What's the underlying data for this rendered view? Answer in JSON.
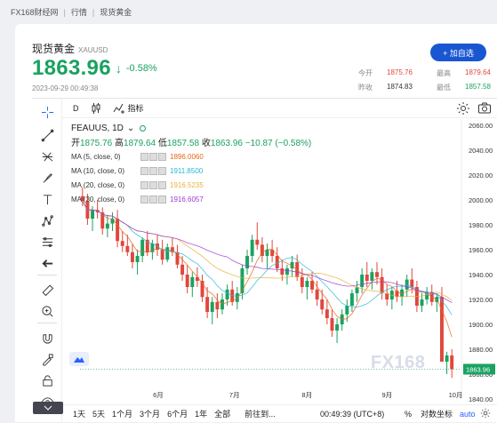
{
  "breadcrumb": [
    "FX168财经网",
    "行情",
    "现货黄金"
  ],
  "instrument": {
    "name": "现货黄金",
    "code": "XAUUSD"
  },
  "quote": {
    "price": "1863.96",
    "change_pct": "-0.58%",
    "datetime": "2023-09-29 00:49:38"
  },
  "add_watch_label": "+ 加自选",
  "stats": {
    "open_label": "今开",
    "open": "1875.76",
    "prev_label": "昨收",
    "prev": "1874.83",
    "high_label": "最高",
    "high": "1879.64",
    "low_label": "最低",
    "low": "1857.58"
  },
  "chart_toolbar": {
    "interval": "D",
    "indicators_label": "指标"
  },
  "legend": {
    "symbol": "FEAUUS, 1D",
    "open_label": "开",
    "open": "1875.76",
    "high_label": "高",
    "high": "1879.64",
    "low_label": "低",
    "low": "1857.58",
    "close_label": "收",
    "close": "1863.96",
    "change": "−10.87 (−0.58%)",
    "ma": [
      {
        "label": "MA (5, close, 0)",
        "value": "1896.0060",
        "color": "#e8661a"
      },
      {
        "label": "MA (10, close, 0)",
        "value": "1911.8500",
        "color": "#27b7d8"
      },
      {
        "label": "MA (20, close, 0)",
        "value": "1916.5235",
        "color": "#e8b23a"
      },
      {
        "label": "MA (30, close, 0)",
        "value": "1916.6057",
        "color": "#9b3bd4"
      }
    ]
  },
  "axis": {
    "y_ticks": [
      "2060.00",
      "2040.00",
      "2020.00",
      "2000.00",
      "1980.00",
      "1960.00",
      "1940.00",
      "1920.00",
      "1900.00",
      "1880.00",
      "1860.00",
      "1840.00"
    ],
    "x_ticks": [
      "6月",
      "7月",
      "8月",
      "9月",
      "10月"
    ],
    "last_price_tag": "1863.96"
  },
  "bottom": {
    "ranges": [
      "1天",
      "5天",
      "1个月",
      "3个月",
      "6个月",
      "1年",
      "全部"
    ],
    "goto": "前往到...",
    "clock": "00:49:39 (UTC+8)",
    "pct": "%",
    "log": "对数坐标",
    "auto": "auto"
  },
  "watermark": "FX168",
  "colors": {
    "up": "#1aa260",
    "down": "#e0473c",
    "accent": "#1956d2"
  },
  "chart_data": {
    "type": "candlestick",
    "ylim": [
      1840,
      2065
    ],
    "x_ticks": [
      "6月",
      "7月",
      "8月",
      "9月",
      "10月"
    ],
    "candles": [
      [
        2003,
        2010,
        1995,
        1999
      ],
      [
        1999,
        2005,
        1980,
        1985
      ],
      [
        1985,
        1995,
        1975,
        1992
      ],
      [
        1992,
        2000,
        1985,
        1990
      ],
      [
        1990,
        1994,
        1972,
        1977
      ],
      [
        1977,
        1988,
        1970,
        1981
      ],
      [
        1981,
        1990,
        1975,
        1985
      ],
      [
        1985,
        1992,
        1962,
        1967
      ],
      [
        1967,
        1975,
        1958,
        1963
      ],
      [
        1963,
        1972,
        1955,
        1958
      ],
      [
        1958,
        1965,
        1945,
        1950
      ],
      [
        1950,
        1960,
        1940,
        1955
      ],
      [
        1955,
        1970,
        1950,
        1968
      ],
      [
        1968,
        1975,
        1955,
        1958
      ],
      [
        1958,
        1968,
        1952,
        1965
      ],
      [
        1965,
        1972,
        1955,
        1960
      ],
      [
        1960,
        1968,
        1948,
        1952
      ],
      [
        1952,
        1965,
        1950,
        1962
      ],
      [
        1962,
        1970,
        1955,
        1958
      ],
      [
        1958,
        1964,
        1945,
        1948
      ],
      [
        1948,
        1955,
        1935,
        1940
      ],
      [
        1940,
        1948,
        1925,
        1930
      ],
      [
        1930,
        1942,
        1922,
        1938
      ],
      [
        1938,
        1946,
        1930,
        1935
      ],
      [
        1935,
        1940,
        1918,
        1922
      ],
      [
        1922,
        1930,
        1905,
        1910
      ],
      [
        1910,
        1922,
        1900,
        1918
      ],
      [
        1918,
        1925,
        1905,
        1912
      ],
      [
        1912,
        1925,
        1908,
        1920
      ],
      [
        1920,
        1932,
        1915,
        1928
      ],
      [
        1928,
        1935,
        1915,
        1918
      ],
      [
        1918,
        1930,
        1912,
        1925
      ],
      [
        1925,
        1948,
        1920,
        1945
      ],
      [
        1945,
        1960,
        1940,
        1955
      ],
      [
        1955,
        1972,
        1950,
        1968
      ],
      [
        1968,
        1982,
        1960,
        1964
      ],
      [
        1964,
        1970,
        1950,
        1955
      ],
      [
        1955,
        1965,
        1945,
        1960
      ],
      [
        1960,
        1968,
        1950,
        1955
      ],
      [
        1955,
        1962,
        1942,
        1945
      ],
      [
        1945,
        1952,
        1935,
        1940
      ],
      [
        1940,
        1948,
        1932,
        1945
      ],
      [
        1945,
        1955,
        1938,
        1950
      ],
      [
        1950,
        1956,
        1935,
        1938
      ],
      [
        1938,
        1945,
        1925,
        1930
      ],
      [
        1930,
        1938,
        1920,
        1935
      ],
      [
        1935,
        1942,
        1925,
        1928
      ],
      [
        1928,
        1935,
        1915,
        1920
      ],
      [
        1920,
        1928,
        1908,
        1912
      ],
      [
        1912,
        1920,
        1900,
        1905
      ],
      [
        1905,
        1912,
        1890,
        1895
      ],
      [
        1895,
        1905,
        1885,
        1900
      ],
      [
        1900,
        1912,
        1895,
        1908
      ],
      [
        1908,
        1920,
        1902,
        1915
      ],
      [
        1915,
        1928,
        1910,
        1925
      ],
      [
        1925,
        1935,
        1918,
        1930
      ],
      [
        1930,
        1945,
        1925,
        1940
      ],
      [
        1940,
        1950,
        1930,
        1935
      ],
      [
        1935,
        1945,
        1928,
        1942
      ],
      [
        1942,
        1950,
        1932,
        1938
      ],
      [
        1938,
        1945,
        1920,
        1925
      ],
      [
        1925,
        1932,
        1915,
        1920
      ],
      [
        1920,
        1930,
        1912,
        1927
      ],
      [
        1927,
        1935,
        1918,
        1922
      ],
      [
        1922,
        1932,
        1915,
        1928
      ],
      [
        1928,
        1940,
        1922,
        1936
      ],
      [
        1936,
        1945,
        1925,
        1930
      ],
      [
        1930,
        1935,
        1910,
        1915
      ],
      [
        1915,
        1925,
        1910,
        1920
      ],
      [
        1920,
        1930,
        1916,
        1926
      ],
      [
        1926,
        1932,
        1915,
        1918
      ],
      [
        1918,
        1925,
        1910,
        1922
      ],
      [
        1922,
        1930,
        1880,
        1870
      ],
      [
        1870,
        1878,
        1860,
        1875
      ],
      [
        1875,
        1880,
        1857,
        1864
      ]
    ]
  }
}
